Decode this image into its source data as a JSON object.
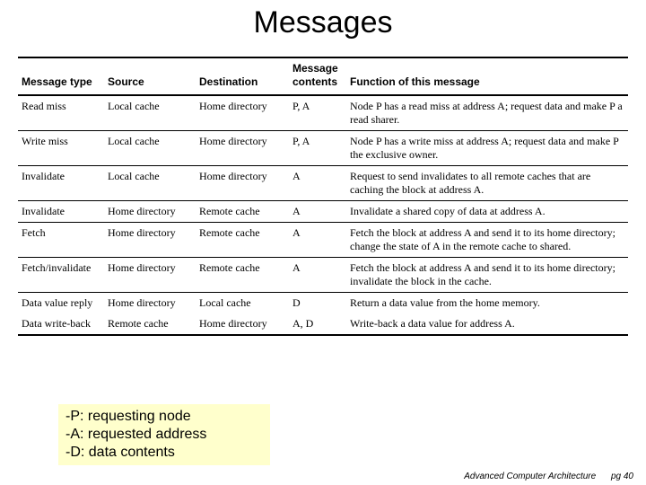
{
  "title": "Messages",
  "columns": {
    "c0": "Message type",
    "c1": "Source",
    "c2": "Destination",
    "c3": "Message contents",
    "c4": "Function of this message"
  },
  "rows": {
    "r0": {
      "type": "Read miss",
      "src": "Local cache",
      "dst": "Home directory",
      "mc": "P, A",
      "fn": "Node P has a read miss at address A; request data and make P a read sharer."
    },
    "r1": {
      "type": "Write miss",
      "src": "Local cache",
      "dst": "Home directory",
      "mc": "P, A",
      "fn": "Node P has a write miss at address A; request data and make P the exclusive owner."
    },
    "r2": {
      "type": "Invalidate",
      "src": "Local cache",
      "dst": "Home directory",
      "mc": "A",
      "fn": "Request to send invalidates to all remote caches that are caching the block at address A."
    },
    "r3": {
      "type": "Invalidate",
      "src": "Home directory",
      "dst": "Remote cache",
      "mc": "A",
      "fn": "Invalidate a shared copy of data at address A."
    },
    "r4": {
      "type": "Fetch",
      "src": "Home directory",
      "dst": "Remote cache",
      "mc": "A",
      "fn": "Fetch the block at address A and send it to its home directory; change the state of A in the remote cache to shared."
    },
    "r5": {
      "type": "Fetch/invalidate",
      "src": "Home directory",
      "dst": "Remote cache",
      "mc": "A",
      "fn": "Fetch the block at address A and send it to its home directory; invalidate the block in the cache."
    },
    "r6": {
      "type": "Data value reply",
      "src": "Home directory",
      "dst": "Local cache",
      "mc": "D",
      "fn": "Return a data value from the home memory."
    },
    "r7": {
      "type": "Data write-back",
      "src": "Remote cache",
      "dst": "Home directory",
      "mc": "A, D",
      "fn": "Write-back a data value for address A."
    }
  },
  "legend": {
    "l0": "-P: requesting node",
    "l1": "-A: requested address",
    "l2": "-D: data contents"
  },
  "footer": {
    "course": "Advanced Computer Architecture",
    "page": "pg 40"
  }
}
